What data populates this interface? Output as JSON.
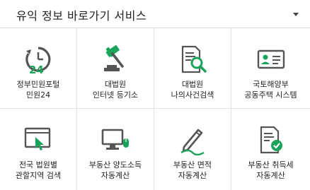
{
  "header": {
    "title": "유익 정보 바로가기 서비스",
    "toggle_icon": "caret-down-icon"
  },
  "colors": {
    "icon_gray": "#555555",
    "icon_green": "#1aa35a",
    "divider": "#e2e2e2"
  },
  "items": [
    {
      "label": "정부민원포털\n민원24",
      "icon": "clock-24-icon"
    },
    {
      "label": "대법원\n인터넷 등기소",
      "icon": "gavel-icon"
    },
    {
      "label": "대법원\n나의사건검색",
      "icon": "document-search-icon"
    },
    {
      "label": "국토해양부\n공동주택 시스템",
      "icon": "id-card-icon"
    },
    {
      "label": "전국 법원별\n관할지역 검색",
      "icon": "browser-click-icon"
    },
    {
      "label": "부동산 양도소득\n자동계산",
      "icon": "monitor-mouse-icon"
    },
    {
      "label": "부동산 면적\n자동계산",
      "icon": "pencil-ruler-icon"
    },
    {
      "label": "부동산 취득세\n자동계산",
      "icon": "document-check-icon"
    }
  ]
}
